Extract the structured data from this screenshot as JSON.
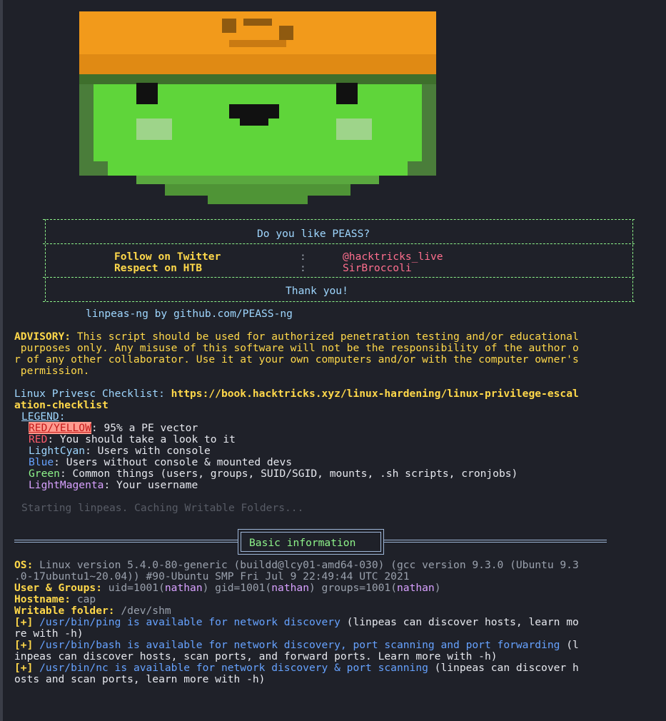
{
  "banner": {
    "question": "Do you like PEASS?",
    "rows": [
      {
        "label": "Follow on Twitter",
        "sep": ":",
        "value": "@hacktricks_live"
      },
      {
        "label": "Respect on HTB",
        "sep": ":",
        "value": "SirBroccoli"
      }
    ],
    "thanks": "Thank you!",
    "byline": "linpeas-ng by github.com/PEASS-ng"
  },
  "advisory": {
    "label": "ADVISORY:",
    "lines": [
      " This script should be used for authorized penetration testing and/or educational",
      " purposes only. Any misuse of this software will not be the responsibility of the author o",
      "r of any other collaborator. Use it at your own computers and/or with the computer owner's",
      " permission."
    ]
  },
  "checklist": {
    "label": "Linux Privesc Checklist:",
    "url_line1": " https://book.hacktricks.xyz/linux-hardening/linux-privilege-escal",
    "url_line2": "ation-checklist"
  },
  "legend": {
    "title": "LEGEND",
    "colon": ":",
    "items": [
      {
        "name": "RED/YELLOW",
        "desc": ": 95% a PE vector"
      },
      {
        "name": "RED",
        "desc": ": You should take a look to it"
      },
      {
        "name": "LightCyan",
        "desc": ": Users with console"
      },
      {
        "name": "Blue",
        "desc": ": Users without console & mounted devs"
      },
      {
        "name": "Green",
        "desc": ": Common things (users, groups, SUID/SGID, mounts, .sh scripts, cronjobs)"
      },
      {
        "name": "LightMagenta",
        "desc": ": Your username"
      }
    ]
  },
  "status": "Starting linpeas. Caching Writable Folders...",
  "section": {
    "title": "Basic information"
  },
  "info": {
    "os_label": "OS:",
    "os_line1": " Linux version 5.4.0-80-generic (buildd@lcy01-amd64-030) (gcc version 9.3.0 (Ubuntu 9.3",
    "os_line2": ".0-17ubuntu1~20.04)) #90-Ubuntu SMP Fri Jul 9 22:49:44 UTC 2021",
    "ug_label": "User & Groups:",
    "ug_p1": " uid=1001(",
    "ug_user": "nathan",
    "ug_p2": ") gid=1001(",
    "ug_p3": ") groups=1001(",
    "ug_p4": ")",
    "host_label": "Hostname:",
    "host_value": " cap",
    "wf_label": "Writable folder:",
    "wf_value": " /dev/shm",
    "plus": "[+]",
    "ping_a": " /usr/bin/ping is available for network discovery",
    "ping_b": " (linpeas can discover hosts, learn mo",
    "ping_c": "re with -h)",
    "bash_a": " /usr/bin/bash is available for network discovery, port scanning and port forwarding",
    "bash_b": " (l",
    "bash_c": "inpeas can discover hosts, scan ports, and forward ports. Learn more with -h)",
    "nc_a": " /usr/bin/nc is available for network discovery & port scanning",
    "nc_b": " (linpeas can discover h",
    "nc_c": "osts and scan ports, learn more with -h)"
  },
  "colors": {
    "background": "#1f2129",
    "yellow": "#ffd84a",
    "cyan": "#9fd7ff",
    "green": "#8ef48a",
    "red": "#ff5c6c",
    "blue": "#66a2ff",
    "magenta": "#d8a1ff"
  }
}
